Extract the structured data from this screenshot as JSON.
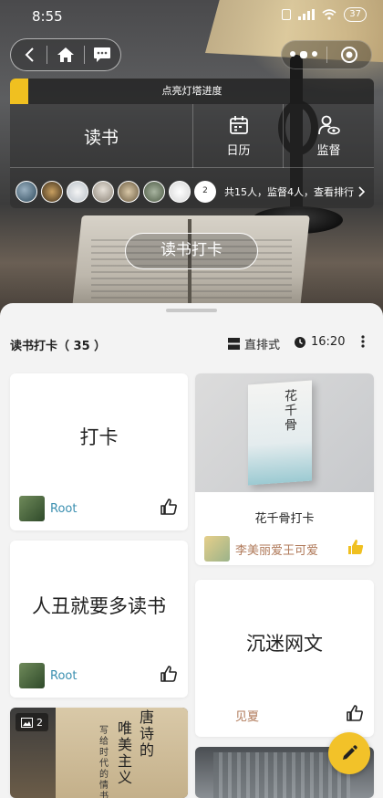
{
  "status": {
    "time": "8:55",
    "battery": "37"
  },
  "icons": {
    "back": "back-icon",
    "home": "home-icon",
    "message": "message-icon",
    "more": "more-dots-icon",
    "close": "capsule-close-icon",
    "calendar": "calendar-icon",
    "supervise": "supervise-icon",
    "chevron": "chevron-right-icon",
    "layout": "layout-icon",
    "clock": "clock-icon",
    "menu": "vertical-more-icon",
    "like": "thumb-up-icon",
    "gallery": "image-count-icon",
    "edit": "pencil-icon"
  },
  "colors": {
    "accent": "#f0c020",
    "link_blue": "#3a8fb0",
    "link_brown": "#b07a5a"
  },
  "panel": {
    "title": "点亮灯塔进度",
    "progress": 0.05,
    "read_label": "读书",
    "calendar_label": "日历",
    "supervise_label": "监督",
    "more_count": "2",
    "summary": "共15人，监督4人，查看排行"
  },
  "checkin_button": "读书打卡",
  "sheet": {
    "title": "读书打卡（ 35 ）",
    "layout_label": "直排式",
    "time_label": "16:20"
  },
  "cards": [
    {
      "text": "打卡",
      "user": "Root"
    },
    {
      "caption": "花千骨打卡",
      "user": "李美丽爱王可爱",
      "cover_title": "花千骨"
    },
    {
      "text": "人丑就要多读书",
      "user": "Root"
    },
    {
      "text": "沉迷网文",
      "user": "见夏"
    },
    {
      "image_count": "2",
      "cover_text_1": "唐诗的",
      "cover_text_2": "唯美主义",
      "cover_text_3": "写给时代的情书"
    }
  ]
}
